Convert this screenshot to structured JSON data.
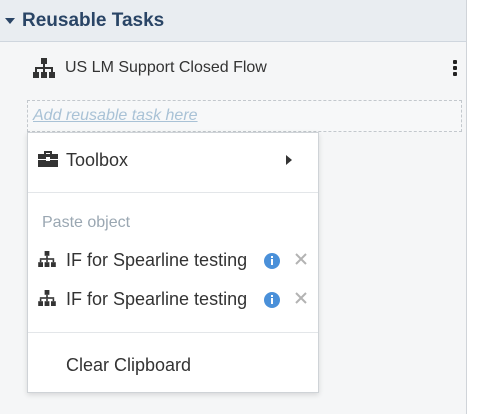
{
  "section": {
    "title": "Reusable Tasks",
    "caret_icon": "caret-down-icon"
  },
  "task": {
    "label": "US LM Support Closed Flow",
    "icon": "hierarchy-icon",
    "menu_icon": "kebab-menu-icon"
  },
  "dropzone": {
    "label": "Add reusable task here"
  },
  "context_menu": {
    "toolbox": {
      "label": "Toolbox",
      "icon": "toolbox-icon",
      "arrow_icon": "caret-right-icon"
    },
    "paste_section_label": "Paste object",
    "paste_items": [
      {
        "label": "IF for Spearline testing",
        "icon": "hierarchy-icon",
        "info_icon": "info-icon",
        "remove_icon": "close-icon"
      },
      {
        "label": "IF for Spearline testing",
        "icon": "hierarchy-icon",
        "info_icon": "info-icon",
        "remove_icon": "close-icon"
      }
    ],
    "clear_label": "Clear Clipboard"
  },
  "colors": {
    "header_text": "#2a4566",
    "header_bg": "#e9edf1",
    "panel_bg": "#f5f6f7",
    "placeholder_link": "#a9c2d6",
    "info_blue": "#4a90d9",
    "muted_label": "#9aa7b2"
  }
}
